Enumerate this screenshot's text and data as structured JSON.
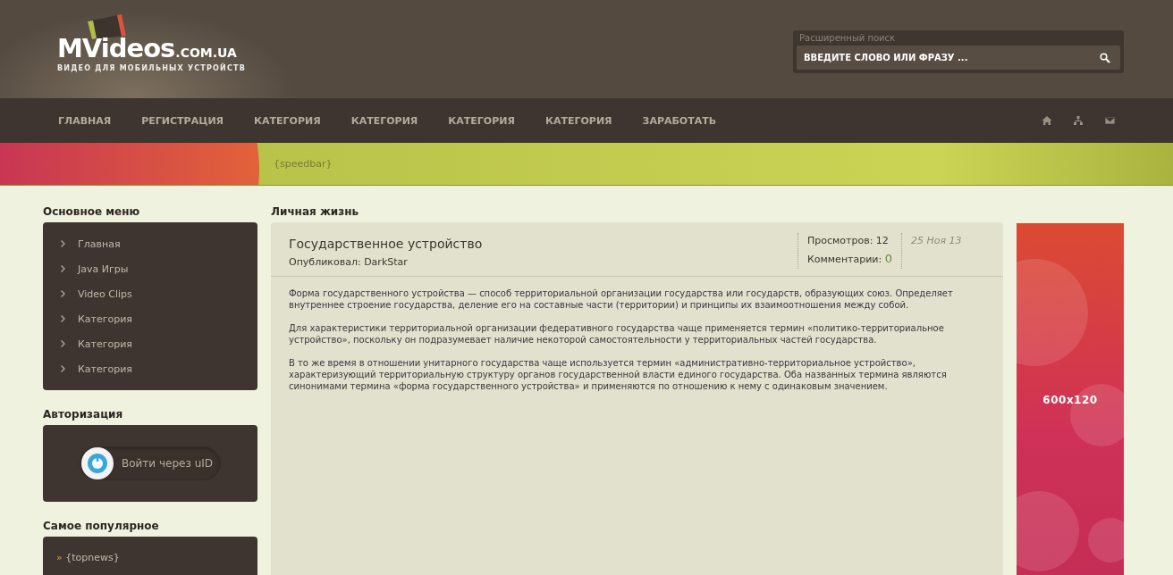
{
  "logo": {
    "name": "MVideos",
    "domain": ".COM.UA",
    "tagline": "ВИДЕО ДЛЯ МОБИЛЬНЫХ УСТРОЙСТВ"
  },
  "search": {
    "label": "Расширенный поиск",
    "placeholder": "ВВЕДИТЕ СЛОВО ИЛИ ФРАЗУ ..."
  },
  "nav": [
    "ГЛАВНАЯ",
    "РЕГИСТРАЦИЯ",
    "КАТЕГОРИЯ",
    "КАТЕГОРИЯ",
    "КАТЕГОРИЯ",
    "КАТЕГОРИЯ",
    "ЗАРАБОТАТЬ"
  ],
  "nav_icons": [
    {
      "kind": "home"
    },
    {
      "kind": "sitemap"
    },
    {
      "kind": "mail"
    }
  ],
  "speedbar": "{speedbar}",
  "sidebar": {
    "menu_title": "Основное меню",
    "menu": [
      "Главная",
      "Java Игры",
      "Video Clips",
      "Категория",
      "Категория",
      "Категория"
    ],
    "auth_title": "Авторизация",
    "auth_button": "Войти через uID",
    "popular_title": "Самое популярное",
    "popular_mark": "»",
    "popular": "{topnews}"
  },
  "content": {
    "section": "Личная жизнь",
    "title": "Государственное устройство",
    "author": "Опубликовал: DarkStar",
    "views_label": "Просмотров:",
    "views": "12",
    "comments_label": "Комментарии:",
    "comments": "0",
    "date": "25 Ноя 13",
    "paragraphs": [
      "Форма государственного устройства — способ территориальной организации государства или государств, образующих союз. Определяет внутреннее строение государства, деление его на составные части (территории) и принципы их взаимоотношения между собой.",
      "Для характеристики территориальной организации федеративного государства чаще применяется термин «политико-территориальное устройство», поскольку он подразумевает наличие некоторой самостоятельности у территориальных частей государства.",
      "В то же время в отношении унитарного государства чаще используется термин «административно-территориальное устройство», характеризующий территориальную структуру органов государственной власти единого государства. Оба названных термина являются синонимами термина «форма государственного устройства» и применяются по отношению к нему с одинаковым значением."
    ]
  },
  "banner": {
    "label": "600x120"
  }
}
